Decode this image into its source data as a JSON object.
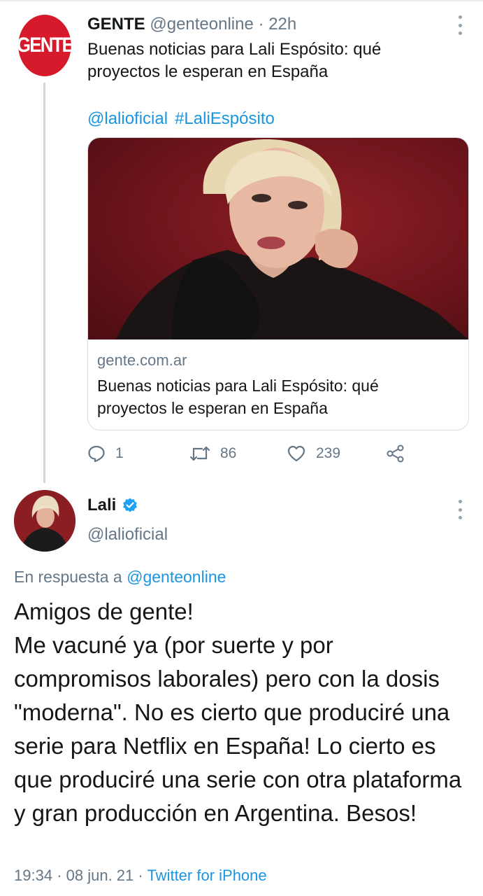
{
  "tweet1": {
    "avatar_text": "GENTE",
    "author_name": "GENTE",
    "author_handle": "@genteonline",
    "separator": "·",
    "time": "22h",
    "text": "Buenas noticias para Lali Espósito: qué proyectos le esperan en España",
    "mention": "@lalioficial",
    "hashtag": "#LaliEspósito",
    "card": {
      "domain": "gente.com.ar",
      "title": "Buenas noticias para Lali Espósito: qué proyectos le esperan en España"
    },
    "actions": {
      "replies": "1",
      "retweets": "86",
      "likes": "239"
    }
  },
  "reply": {
    "author_name": "Lali",
    "author_handle": "@lalioficial",
    "reply_prefix": "En respuesta a",
    "reply_mention": "@genteonline",
    "text": "Amigos de gente!\nMe vacuné ya (por suerte y por compromisos laborales) pero con la dosis \"moderna\". No es cierto que produciré una serie para Netflix en España! Lo cierto es que produciré una serie con otra plataforma y gran producción en Argentina. Besos!",
    "time": "19:34",
    "date": "08 jun. 21",
    "source": "Twitter for iPhone"
  },
  "colors": {
    "link": "#1b95e0",
    "secondary": "#657786",
    "gente_red": "#d7192c",
    "verified": "#1da1f2"
  },
  "icons": [
    "more-icon",
    "reply-icon",
    "retweet-icon",
    "like-icon",
    "share-icon",
    "verified-badge-icon"
  ]
}
